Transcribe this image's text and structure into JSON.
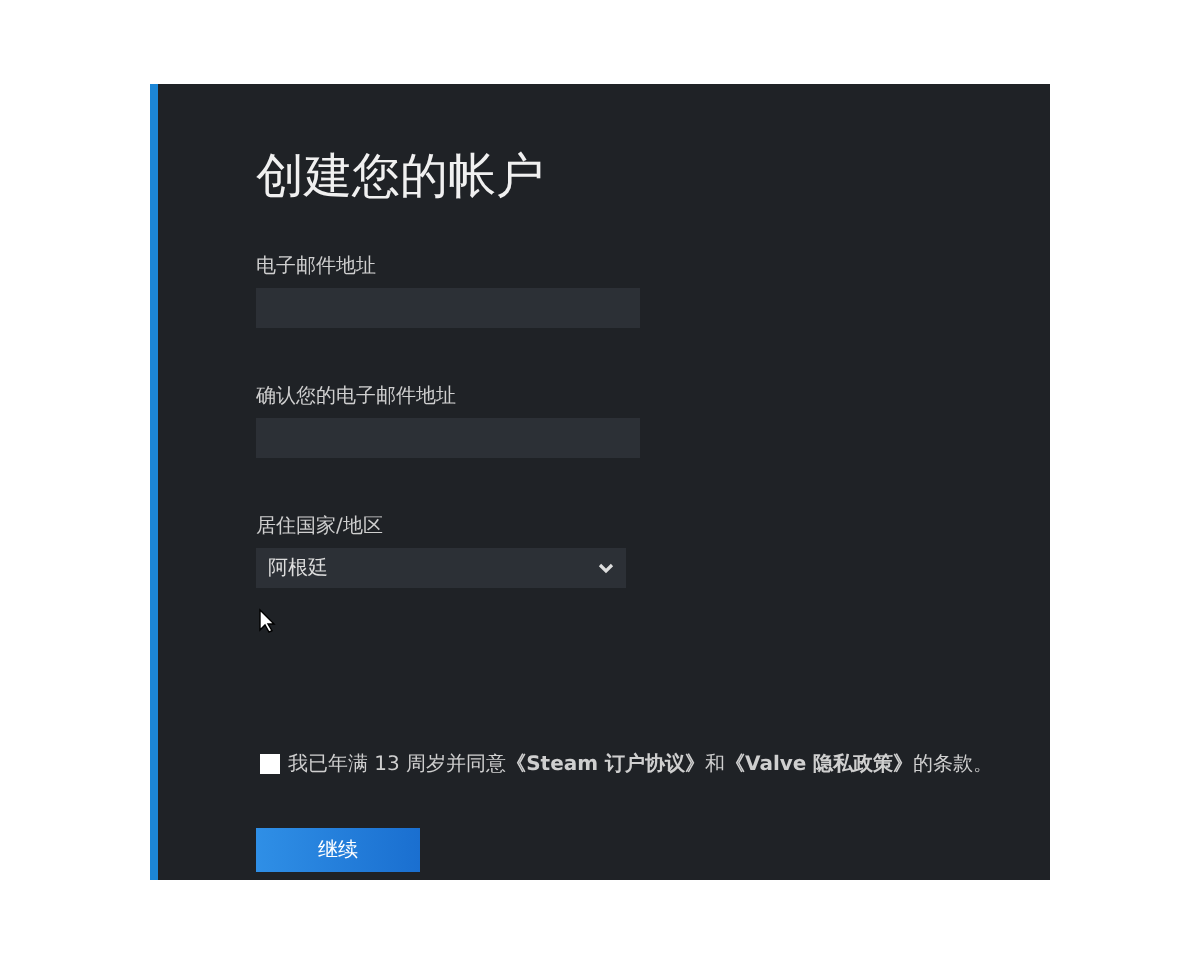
{
  "title": "创建您的帐户",
  "fields": [
    {
      "label": "电子邮件地址",
      "kind": "text"
    },
    {
      "label": "确认您的电子邮件地址",
      "kind": "text"
    },
    {
      "label": "居住国家/地区",
      "kind": "select",
      "value": "阿根廷"
    }
  ],
  "agreement": {
    "checked": false,
    "text": "我已年满 13 周岁并同意**《Steam 订户协议》**和**《Valve 隐私政策》**的条款。"
  },
  "button": "继续"
}
